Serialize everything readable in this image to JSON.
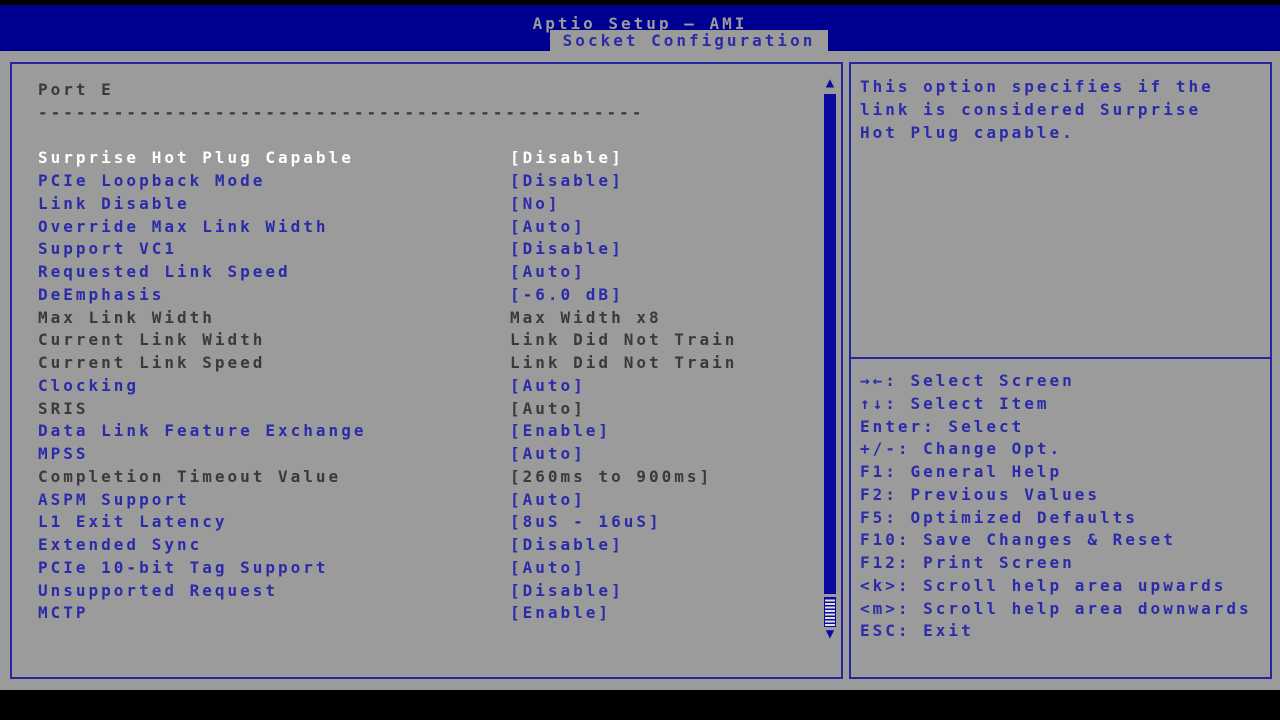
{
  "header": {
    "title": "Aptio Setup – AMI",
    "tab": "Socket Configuration"
  },
  "menu": {
    "section_title": "Port E",
    "separator": "------------------------------------------------",
    "items": [
      {
        "label": "Surprise Hot Plug Capable",
        "value": "[Disable]",
        "state": "selected"
      },
      {
        "label": "PCIe Loopback Mode",
        "value": "[Disable]",
        "state": "normal"
      },
      {
        "label": "Link Disable",
        "value": "[No]",
        "state": "normal"
      },
      {
        "label": "Override Max Link Width",
        "value": "[Auto]",
        "state": "normal"
      },
      {
        "label": "Support VC1",
        "value": "[Disable]",
        "state": "normal"
      },
      {
        "label": "Requested Link Speed",
        "value": "[Auto]",
        "state": "normal"
      },
      {
        "label": "DeEmphasis",
        "value": "[-6.0 dB]",
        "state": "normal"
      },
      {
        "label": "Max Link Width",
        "value": "Max Width x8",
        "state": "readonly"
      },
      {
        "label": "Current Link Width",
        "value": "Link Did Not Train",
        "state": "readonly"
      },
      {
        "label": "Current Link Speed",
        "value": "Link Did Not Train",
        "state": "readonly"
      },
      {
        "label": "Clocking",
        "value": "[Auto]",
        "state": "normal"
      },
      {
        "label": "SRIS",
        "value": "[Auto]",
        "state": "readonly"
      },
      {
        "label": "Data Link Feature Exchange",
        "value": "[Enable]",
        "state": "normal"
      },
      {
        "label": "MPSS",
        "value": "[Auto]",
        "state": "normal"
      },
      {
        "label": "Completion Timeout Value",
        "value": "[260ms to 900ms]",
        "state": "readonly"
      },
      {
        "label": "ASPM Support",
        "value": "[Auto]",
        "state": "normal"
      },
      {
        "label": "L1 Exit Latency",
        "value": "[8uS - 16uS]",
        "state": "normal"
      },
      {
        "label": "Extended Sync",
        "value": "[Disable]",
        "state": "normal"
      },
      {
        "label": "PCIe 10-bit Tag Support",
        "value": "[Auto]",
        "state": "normal"
      },
      {
        "label": "Unsupported Request",
        "value": "[Disable]",
        "state": "normal"
      },
      {
        "label": "MCTP",
        "value": "[Enable]",
        "state": "normal"
      }
    ]
  },
  "help": {
    "text": "This option specifies if the link is considered Surprise Hot Plug capable."
  },
  "legend": {
    "items": [
      "→←: Select Screen",
      "↑↓: Select Item",
      "Enter: Select",
      "+/-: Change Opt.",
      "F1: General Help",
      "F2: Previous Values",
      "F5: Optimized Defaults",
      "F10: Save Changes & Reset",
      "F12: Print Screen",
      "<k>: Scroll help area upwards",
      "<m>: Scroll help area downwards",
      "ESC: Exit"
    ]
  },
  "scrollbar": {
    "up_icon": "▲",
    "down_icon": "▼"
  },
  "colors": {
    "background_gray": "#9b9b9b",
    "band_blue": "#000090",
    "text_blue": "#2b2baa",
    "readonly_dark": "#3a3a3a",
    "selected_white": "#ffffff",
    "scrollbar_blue": "#0a0aa0",
    "border_blue": "#2525a0"
  }
}
